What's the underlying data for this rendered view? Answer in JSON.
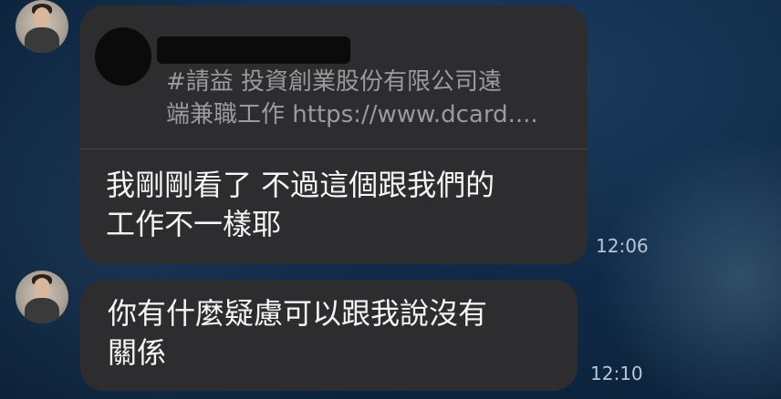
{
  "messages": [
    {
      "quoted": {
        "text_lines": [
          "#請益 投資創業股份有限公司遠",
          "端兼職工作 https://www.dcard...."
        ]
      },
      "text_lines": [
        "我剛剛看了 不過這個跟我們的",
        "工作不一樣耶"
      ],
      "time": "12:06"
    },
    {
      "text_lines": [
        "你有什麼疑慮可以跟我說沒有",
        "關係"
      ],
      "time": "12:10"
    }
  ],
  "colors": {
    "bubble": "#2d2d2f",
    "background": "#0f2a47",
    "quote_text": "#9b9b9d",
    "message_text": "#f5f5f5",
    "time_text": "#b8c6d6"
  },
  "icons": [
    "user-avatar"
  ]
}
